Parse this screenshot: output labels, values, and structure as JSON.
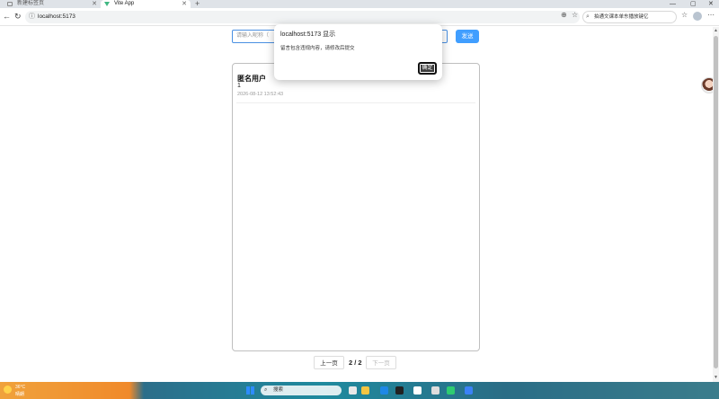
{
  "browser": {
    "tabs": [
      {
        "title": "新建标签页"
      },
      {
        "title": "Vite App"
      }
    ],
    "address": "localhost:5173",
    "search_text": "拍通文课本单东播放键亿"
  },
  "page": {
    "input_placeholder": "请输入昵称（",
    "send_label": "发送",
    "messages": [
      {
        "user": "匿名用户",
        "text": "1",
        "time": "2026-08-12 13:52:43"
      }
    ],
    "pager": {
      "prev": "上一页",
      "info": "2 / 2",
      "next": "下一页"
    }
  },
  "dialog": {
    "title": "localhost:5173 显示",
    "message": "留言包含违规内容，请修改后提交",
    "ok_label": "确定"
  },
  "taskbar": {
    "weather_temp": "36°C",
    "weather_desc": "晴朗",
    "search_label": "搜索"
  },
  "colors": {
    "accent": "#409eff",
    "dialog_ok": "#3c3c3c"
  }
}
